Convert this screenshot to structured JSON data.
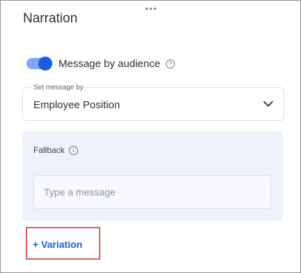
{
  "panel": {
    "title": "Narration",
    "drag_handle": "•••"
  },
  "audience_toggle": {
    "label": "Message by audience",
    "enabled": true,
    "help_icon": "question-circle-icon"
  },
  "set_message_by": {
    "caption": "Set message by",
    "value": "Employee Position",
    "icon": "chevron-down-icon"
  },
  "fallback": {
    "label": "Fallback",
    "info_icon": "info-circle-icon",
    "placeholder": "Type a message"
  },
  "variation": {
    "label": "+ Variation"
  },
  "colors": {
    "accent": "#1a5fdc",
    "highlight_border": "#e05a5a",
    "panel_bg": "#eef2fa"
  }
}
